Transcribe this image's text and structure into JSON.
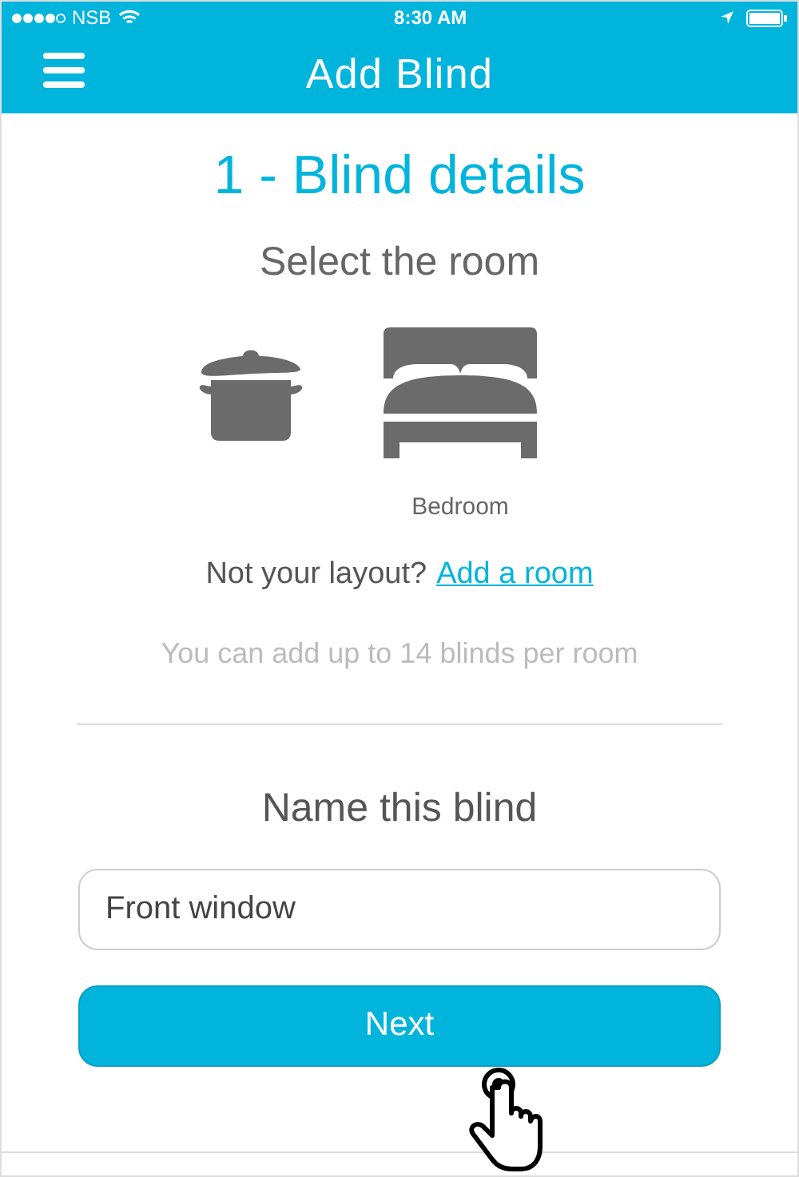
{
  "status_bar": {
    "carrier": "NSB",
    "time": "8:30 AM"
  },
  "header": {
    "title": "Add Blind"
  },
  "step_title": "1 - Blind details",
  "room_prompt": "Select the room",
  "rooms": [
    {
      "kind": "kitchen"
    },
    {
      "kind": "bedroom",
      "label": "Bedroom"
    }
  ],
  "layout_prompt": {
    "text": "Not your layout?",
    "link": "Add a room"
  },
  "hint": "You can add up to 14 blinds per room",
  "name_prompt": "Name this blind",
  "name_field": {
    "value": "Front window"
  },
  "next_button": "Next"
}
